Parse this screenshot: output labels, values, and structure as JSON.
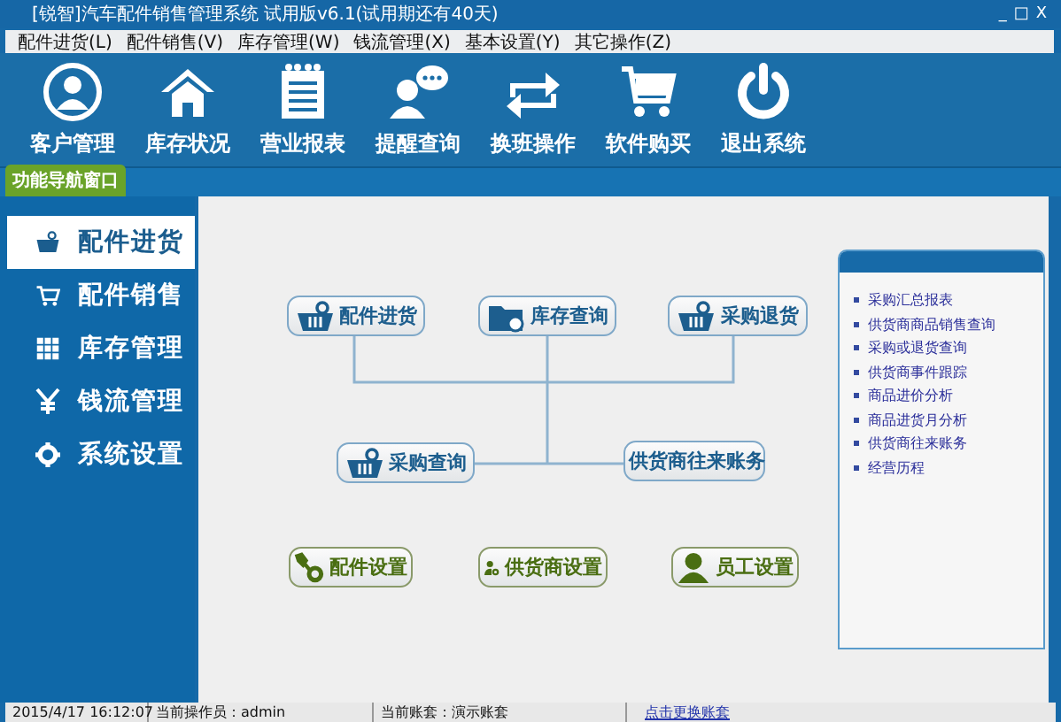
{
  "window": {
    "title": "[锐智]汽车配件销售管理系统 试用版v6.1(试用期还有40天)",
    "controls": [
      "_",
      "□",
      "X"
    ]
  },
  "menu": [
    "配件进货(L)",
    "配件销售(V)",
    "库存管理(W)",
    "钱流管理(X)",
    "基本设置(Y)",
    "其它操作(Z)"
  ],
  "toolbar": [
    "客户管理",
    "库存状况",
    "营业报表",
    "提醒查询",
    "换班操作",
    "软件购买",
    "退出系统"
  ],
  "nav_tab": "功能导航窗口",
  "sidebar": {
    "items": [
      {
        "label": "配件进货",
        "selected": true
      },
      {
        "label": "配件销售",
        "selected": false
      },
      {
        "label": "库存管理",
        "selected": false
      },
      {
        "label": "钱流管理",
        "selected": false
      },
      {
        "label": "系统设置",
        "selected": false
      }
    ]
  },
  "diagram": {
    "nodes": [
      {
        "label": "配件进货",
        "kind": "task"
      },
      {
        "label": "库存查询",
        "kind": "task"
      },
      {
        "label": "采购退货",
        "kind": "task"
      },
      {
        "label": "采购查询",
        "kind": "task"
      },
      {
        "label": "供货商往来账务",
        "kind": "task"
      },
      {
        "label": "配件设置",
        "kind": "setup"
      },
      {
        "label": "供货商设置",
        "kind": "setup"
      },
      {
        "label": "员工设置",
        "kind": "setup"
      }
    ]
  },
  "report_panel": {
    "links": [
      "采购汇总报表",
      "供货商商品销售查询",
      "采购或退货查询",
      "供货商事件跟踪",
      "商品进价分析",
      "商品进货月分析",
      "供货商往来账务",
      "经营历程"
    ]
  },
  "status_bar": {
    "time": "2015/4/17 16:12:07",
    "operator": "当前操作员：admin",
    "account": "当前账套：演示账套",
    "switch_link": "点击更换账套"
  }
}
